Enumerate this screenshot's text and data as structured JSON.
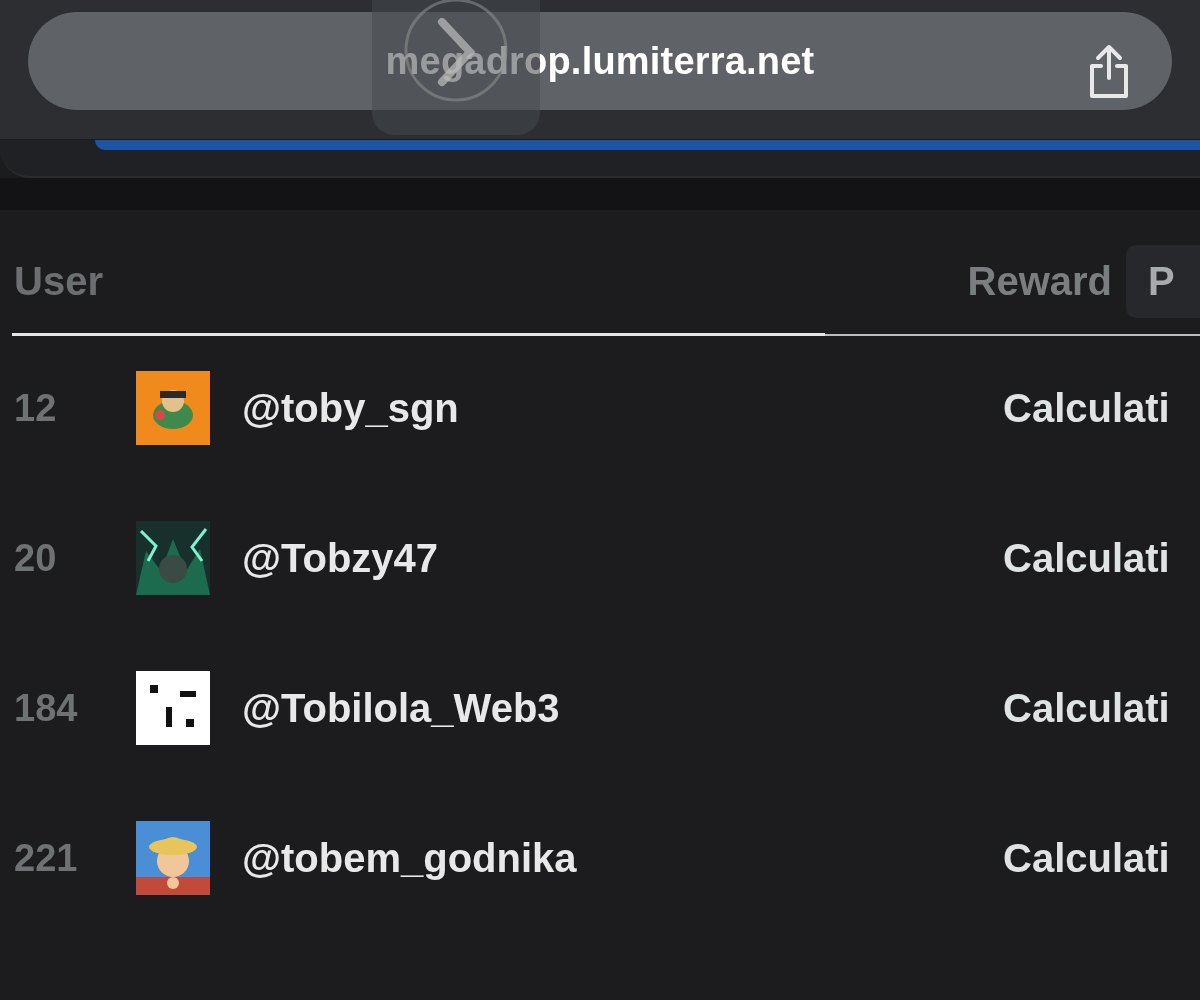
{
  "browser": {
    "url": "megadrop.lumiterra.net"
  },
  "table": {
    "columns": [
      {
        "label": "User"
      },
      {
        "label": "Reward"
      },
      {
        "label": "P"
      }
    ],
    "rows": [
      {
        "rank": "12",
        "handle": "@toby_sgn",
        "reward": "Calculati"
      },
      {
        "rank": "20",
        "handle": "@Tobzy47",
        "reward": "Calculati"
      },
      {
        "rank": "184",
        "handle": "@Tobilola_Web3",
        "reward": "Calculati"
      },
      {
        "rank": "221",
        "handle": "@tobem_godnika",
        "reward": "Calculati"
      }
    ]
  }
}
